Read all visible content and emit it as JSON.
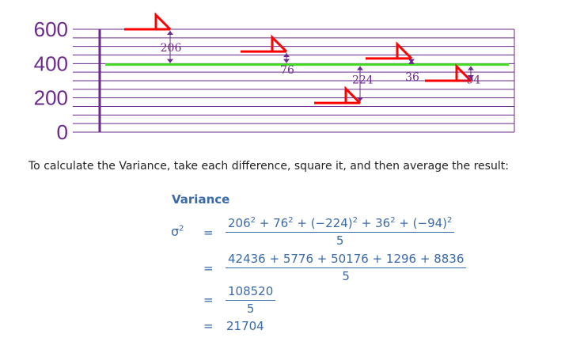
{
  "chart_data": {
    "type": "line",
    "yticks": [
      "600",
      "400",
      "200",
      "0"
    ],
    "ylim": [
      0,
      600
    ],
    "mean": 394,
    "bars": [
      {
        "diff": 206,
        "label": "206"
      },
      {
        "diff": 76,
        "label": "76"
      },
      {
        "diff": -224,
        "label": "-224"
      },
      {
        "diff": 36,
        "label": "36"
      },
      {
        "diff": -94,
        "label": "-94"
      }
    ],
    "colors": {
      "mean_line": "#44dd22",
      "grid": "#6a2a8a",
      "tick_text": "#6a2a8a",
      "dog_marker": "#ff0000",
      "arrow": "#6a2a8a"
    }
  },
  "text": {
    "intro": "To calculate the Variance, take each difference, square it, and then average the result:",
    "variance_title": "Variance",
    "sigma_symbol": "σ",
    "sigma_power": "2",
    "equals": "=",
    "step1_num": {
      "t1": "206",
      "t2": "76",
      "t3": "(−224)",
      "t4": "36",
      "t5": "(−94)",
      "exp": "2",
      "plus": " + "
    },
    "step1_den": "5",
    "step2_num": "42436 + 5776 + 50176 + 1296 + 8836",
    "step2_den": "5",
    "step3_num": "108520",
    "step3_den": "5",
    "result": "21704"
  }
}
